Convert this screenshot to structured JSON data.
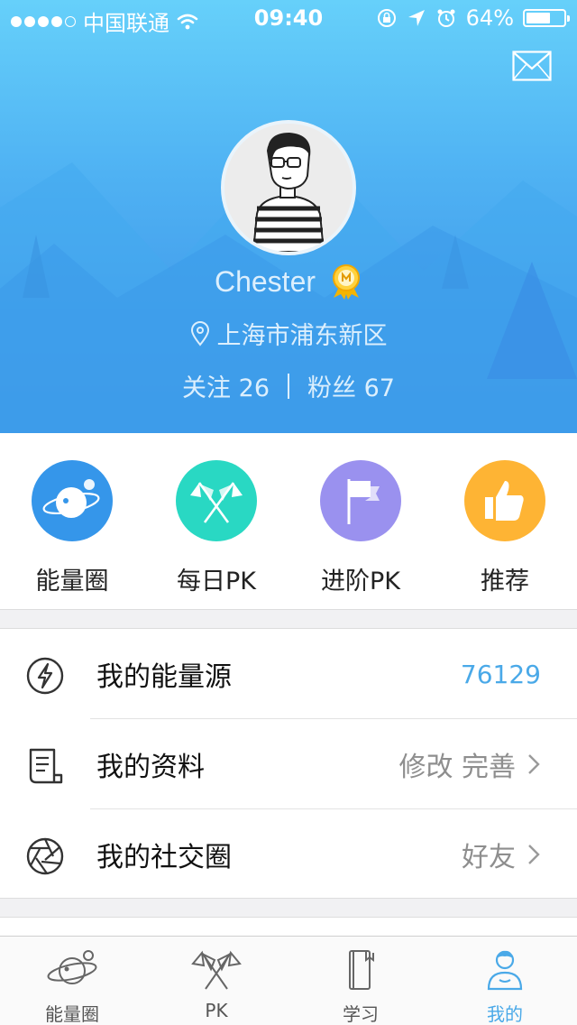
{
  "status_bar": {
    "carrier": "中国联通",
    "time": "09:40",
    "battery": "64%",
    "battery_level": 0.64,
    "signal_dots": 5,
    "signal_filled": 4
  },
  "profile": {
    "name": "Chester",
    "location": "上海市浦东新区",
    "following_label": "关注",
    "following_count": "26",
    "fans_label": "粉丝",
    "fans_count": "67"
  },
  "quick_actions": [
    {
      "label": "能量圈",
      "icon": "planet-icon",
      "color": "#3596ea"
    },
    {
      "label": "每日PK",
      "icon": "crossed-flags-icon",
      "color": "#29d8c3"
    },
    {
      "label": "进阶PK",
      "icon": "flag-icon",
      "color": "#9a91ef"
    },
    {
      "label": "推荐",
      "icon": "thumbs-up-icon",
      "color": "#feb434"
    }
  ],
  "menu": {
    "energy": {
      "title": "我的能量源",
      "value": "76129",
      "icon": "lightning-icon"
    },
    "profile": {
      "title": "我的资料",
      "meta": "修改 完善",
      "icon": "document-icon"
    },
    "social": {
      "title": "我的社交圈",
      "meta": "好友",
      "icon": "aperture-icon"
    }
  },
  "tabs": [
    {
      "label": "能量圈",
      "icon": "planet-icon",
      "active": false
    },
    {
      "label": "PK",
      "icon": "crossed-flags-icon",
      "active": false
    },
    {
      "label": "学习",
      "icon": "book-icon",
      "active": false
    },
    {
      "label": "我的",
      "icon": "user-icon",
      "active": true
    }
  ],
  "colors": {
    "accent": "#4aa9e8",
    "header_top": "#66d0fa",
    "header_bottom": "#3a8de6"
  }
}
